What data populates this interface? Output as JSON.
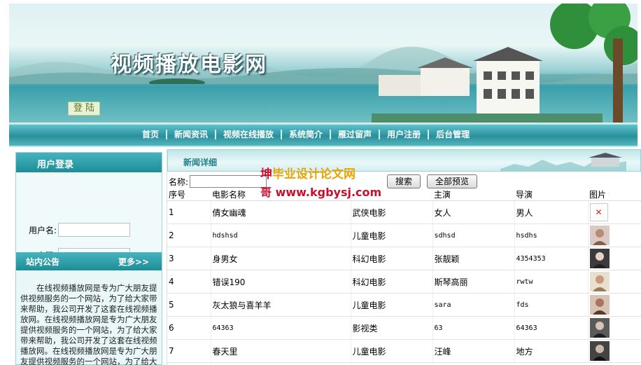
{
  "site": {
    "title": "视频播放电影网"
  },
  "nav": {
    "items": [
      "首页",
      "新闻资讯",
      "视频在线播放",
      "系统简介",
      "雁过留声",
      "用户注册",
      "后台管理"
    ]
  },
  "login": {
    "title": "用户登录",
    "username_label": "用户名:",
    "password_label": "密码:",
    "submit_label": "登 陆"
  },
  "notice": {
    "title": "站内公告",
    "more_label": "更多>>",
    "text": "在线视频播放网是专为广大朋友提供视频服务的一个网站，为了给大家带来帮助，我公司开发了这套在线视频播放网。在线视频播放网是专为广大朋友提供视频服务的一个网站，为了给大家带来帮助，我公司开发了这套在线视频播放网。在线视频播放网是专为广大朋友提供视频服务的一个网站，为了给大家带来帮助，我公司开发了这套在线视频播放网。"
  },
  "watermark": {
    "line1a": "坤",
    "line1b": "毕业设计论文网",
    "line2a": "哥",
    "line2b": " www.kgbysj.com"
  },
  "news": {
    "title": "新闻详细",
    "search_label": "名称:",
    "search_value": "",
    "search_button": "搜索",
    "show_all_button": "全部预览",
    "columns": [
      "序号",
      "电影名称",
      "",
      "主演",
      "导演",
      "图片"
    ],
    "rows": [
      {
        "id": "1",
        "name": "倩女幽魂",
        "category": "武侠电影",
        "star": "女人",
        "director": "男人",
        "image": "broken"
      },
      {
        "id": "2",
        "name": "hdshsd",
        "category": "儿童电影",
        "star": "sdhsd",
        "director": "hsdhs",
        "image": "photo"
      },
      {
        "id": "3",
        "name": "身男女",
        "category": "科幻电影",
        "star": "张靓颖",
        "director": "4354353",
        "image": "photo"
      },
      {
        "id": "4",
        "name": "错误190",
        "category": "科幻电影",
        "star": "斯琴高丽",
        "director": "rwtw",
        "image": "photo"
      },
      {
        "id": "5",
        "name": "灰太狼与喜羊羊",
        "category": "儿童电影",
        "star": "sara",
        "director": "fds",
        "image": "photo"
      },
      {
        "id": "6",
        "name": "64363",
        "category": "影视类",
        "star": "63",
        "director": "64363",
        "image": "photo"
      },
      {
        "id": "7",
        "name": "春天里",
        "category": "儿童电影",
        "star": "汪峰",
        "director": "地方",
        "image": "photo"
      }
    ]
  },
  "colors": {
    "accent": "#2a8f9b",
    "nav_text": "#ffffff",
    "watermark": "#c8102e"
  }
}
